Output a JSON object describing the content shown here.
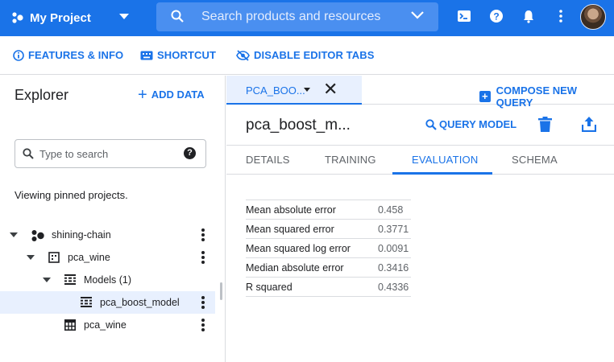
{
  "topbar": {
    "project_name": "My Project",
    "search_placeholder": "Search products and resources",
    "accent": "#1a73e8"
  },
  "actions": {
    "features_label": "FEATURES & INFO",
    "shortcut_label": "SHORTCUT",
    "disable_tabs_label": "DISABLE EDITOR TABS"
  },
  "explorer": {
    "title": "Explorer",
    "add_data_label": "ADD DATA",
    "search_placeholder": "Type to search",
    "pinned_text": "Viewing pinned projects.",
    "tree": [
      {
        "label": "shining-chain",
        "icon": "project-icon"
      },
      {
        "label": "pca_wine",
        "icon": "dataset-icon"
      },
      {
        "label": "Models (1)",
        "icon": "models-folder-icon"
      },
      {
        "label": "pca_boost_model",
        "icon": "model-icon",
        "selected": true
      },
      {
        "label": "pca_wine",
        "icon": "table-icon"
      }
    ]
  },
  "editor": {
    "tab_label": "PCA_BOO...",
    "compose_label": "COMPOSE NEW QUERY",
    "model_title": "pca_boost_m...",
    "query_model_label": "QUERY MODEL",
    "subtabs": [
      {
        "label": "DETAILS"
      },
      {
        "label": "TRAINING"
      },
      {
        "label": "EVALUATION",
        "active": true
      },
      {
        "label": "SCHEMA"
      }
    ],
    "evaluation": [
      {
        "metric": "Mean absolute error",
        "value": "0.458"
      },
      {
        "metric": "Mean squared error",
        "value": "0.3771"
      },
      {
        "metric": "Mean squared log error",
        "value": "0.0091"
      },
      {
        "metric": "Median absolute error",
        "value": "0.3416"
      },
      {
        "metric": "R squared",
        "value": "0.4336"
      }
    ]
  }
}
